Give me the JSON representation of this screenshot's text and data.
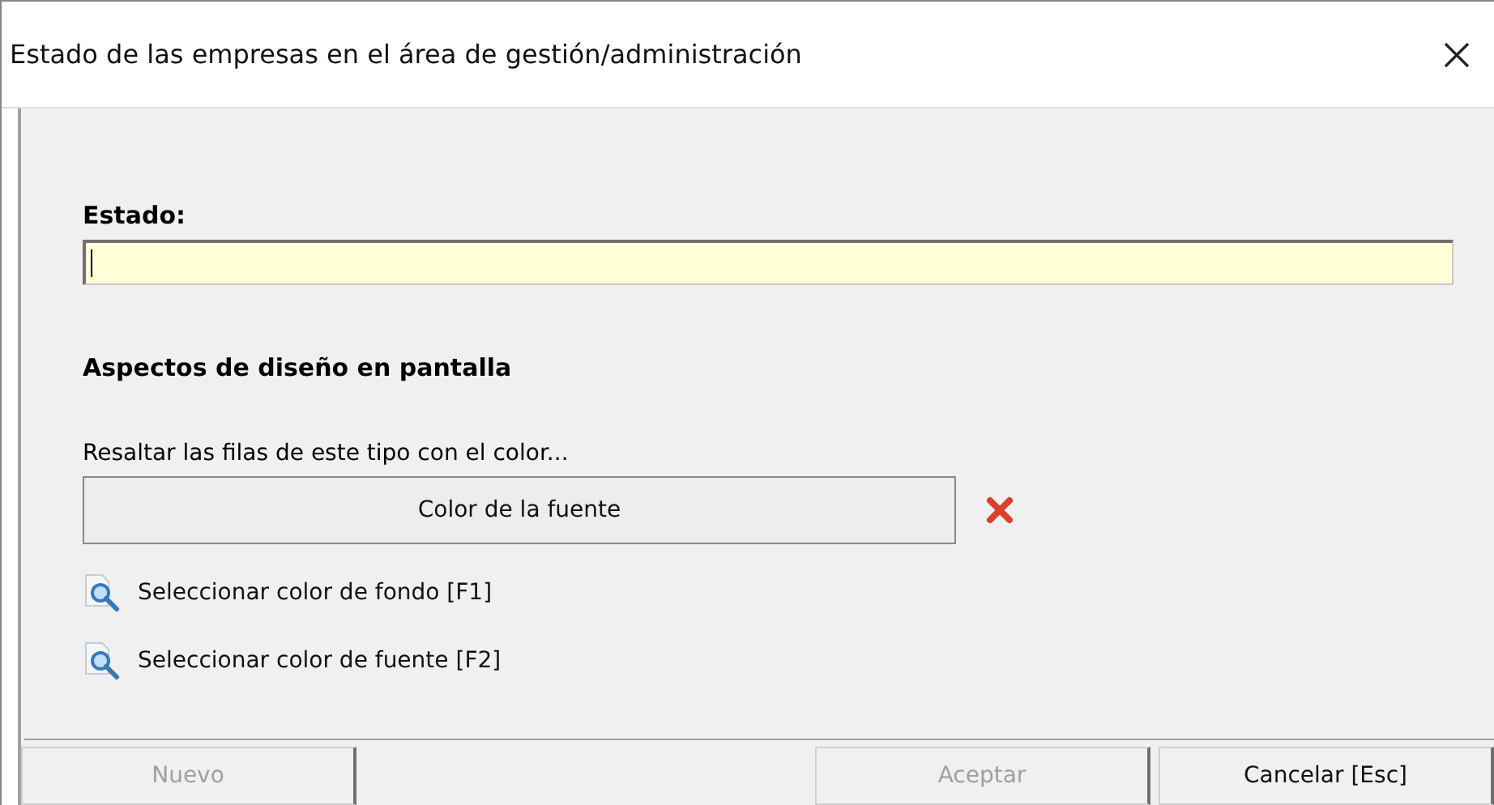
{
  "window": {
    "title": "Estado de las empresas en el área de gestión/administración"
  },
  "estado": {
    "label": "Estado:",
    "focused": true
  },
  "design": {
    "heading": "Aspectos de diseño en pantalla",
    "hint": "Resaltar las filas de este tipo con el color...",
    "color_button": "Color de la fuente",
    "links": [
      {
        "label": "Seleccionar color de fondo  [F1]"
      },
      {
        "label": "Seleccionar color de fuente  [F2]"
      }
    ]
  },
  "buttons": [
    {
      "label": "Nuevo",
      "disabled": true,
      "kind": "left"
    },
    {
      "label": "Aceptar",
      "disabled": true,
      "kind": "right"
    },
    {
      "label": "Cancelar [Esc]",
      "disabled": false,
      "kind": "right"
    }
  ]
}
